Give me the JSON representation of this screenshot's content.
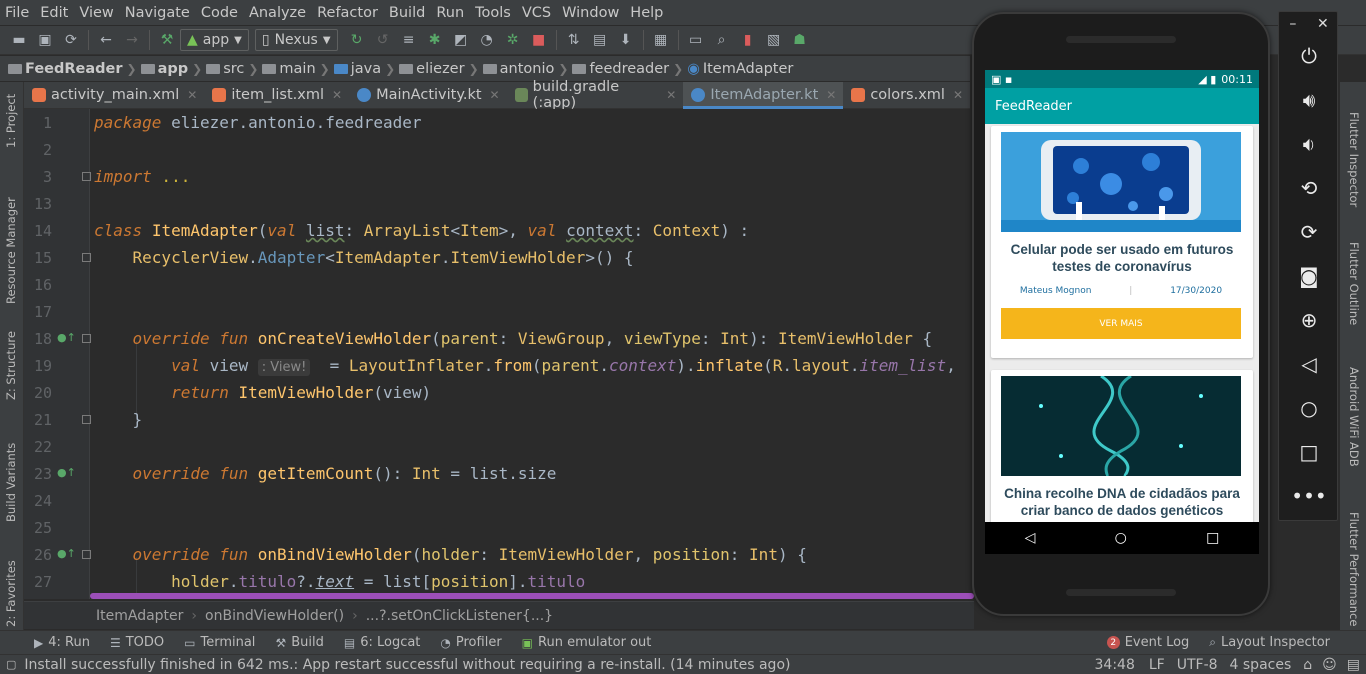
{
  "menu": [
    "File",
    "Edit",
    "View",
    "Navigate",
    "Code",
    "Analyze",
    "Refactor",
    "Build",
    "Run",
    "Tools",
    "VCS",
    "Window",
    "Help"
  ],
  "toolbar": {
    "config": "app",
    "device": "Nexus"
  },
  "breadcrumb": [
    "FeedReader",
    "app",
    "src",
    "main",
    "java",
    "eliezer",
    "antonio",
    "feedreader",
    "ItemAdapter"
  ],
  "tabs": [
    {
      "label": "activity_main.xml",
      "color": "#e8754a"
    },
    {
      "label": "item_list.xml",
      "color": "#e8754a"
    },
    {
      "label": "MainActivity.kt",
      "color": "#4a88c7"
    },
    {
      "label": "build.gradle (:app)",
      "color": "#6a8759"
    },
    {
      "label": "ItemAdapter.kt",
      "color": "#4a88c7",
      "active": true
    },
    {
      "label": "colors.xml",
      "color": "#e8754a"
    }
  ],
  "left_tools": [
    "1: Project",
    "Resource Manager",
    "Z: Structure",
    "Build Variants",
    "2: Favorites"
  ],
  "right_tools": [
    "Flutter Inspector",
    "Flutter Outline",
    "Android WiFi ADB",
    "Flutter Performance"
  ],
  "code": {
    "line_numbers": [
      "1",
      "2",
      "3",
      "13",
      "14",
      "15",
      "16",
      "17",
      "18",
      "19",
      "20",
      "21",
      "22",
      "23",
      "24",
      "25",
      "26",
      "27"
    ],
    "package_kw": "package",
    "package_name": " eliezer.antonio.feedreader",
    "import_kw": "import",
    "import_rest": " ...",
    "inlay_hint": ": View!"
  },
  "editor_crumbs": [
    "ItemAdapter",
    "onBindViewHolder()",
    "...?.setOnClickListener{...}"
  ],
  "bottom_tabs": [
    "4: Run",
    "TODO",
    "Terminal",
    "Build",
    "6: Logcat",
    "Profiler",
    "Run emulator out"
  ],
  "bottom_right": {
    "event_log": "Event Log",
    "event_count": "2",
    "layout_inspector": "Layout Inspector"
  },
  "status": {
    "message": "Install successfully finished in 642 ms.: App restart successful without requiring a re-install. (14 minutes ago)",
    "position": "34:48",
    "line_sep": "LF",
    "encoding": "UTF-8",
    "indent": "4 spaces"
  },
  "phone": {
    "time": "00:11",
    "app_title": "FeedReader",
    "cards": [
      {
        "title": "Celular pode ser usado em futuros testes de coronavírus",
        "author": "Mateus Mognon",
        "date": "17/30/2020",
        "button": "VER MAIS"
      },
      {
        "title": "China recolhe DNA de cidadãos para criar banco de dados genéticos"
      }
    ]
  }
}
